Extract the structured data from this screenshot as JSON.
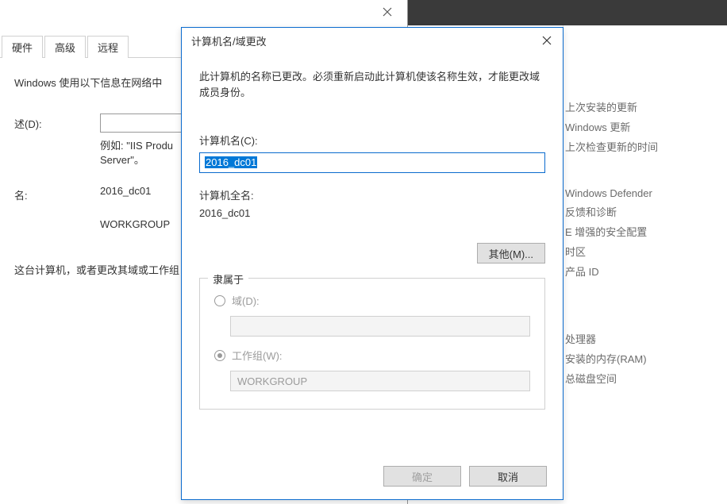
{
  "bgWindow": {
    "tabs": [
      "硬件",
      "高级",
      "远程"
    ],
    "desc": "Windows 使用以下信息在网络中",
    "descLabel": "述(D):",
    "example": "例如: \"IIS Produ\nServer\"。",
    "nameLabel": "名:",
    "nameValue": "2016_dc01",
    "workgroupValue": "WORKGROUP",
    "renameText": "这台计算机，或者更改其域或工作组"
  },
  "dialog": {
    "title": "计算机名/域更改",
    "desc": "此计算机的名称已更改。必须重新启动此计算机使该名称生效，才能更改域成员身份。",
    "compNameLabel": "计算机名(C):",
    "compNameValue": "2016_dc01",
    "fullNameLabel": "计算机全名:",
    "fullNameValue": "2016_dc01",
    "otherButton": "其他(M)...",
    "membership": {
      "legend": "隶属于",
      "domainLabel": "域(D):",
      "domainValue": "",
      "workgroupLabel": "工作组(W):",
      "workgroupValue": "WORKGROUP"
    },
    "okButton": "确定",
    "cancelButton": "取消"
  },
  "sidePanel": {
    "group1": [
      "上次安装的更新",
      "Windows 更新",
      "上次检查更新的时间"
    ],
    "group2": [
      "Windows Defender",
      "反馈和诊断",
      "E 增强的安全配置",
      "时区",
      "产品 ID"
    ],
    "group3": [
      "处理器",
      "安装的内存(RAM)",
      "总磁盘空间"
    ]
  }
}
